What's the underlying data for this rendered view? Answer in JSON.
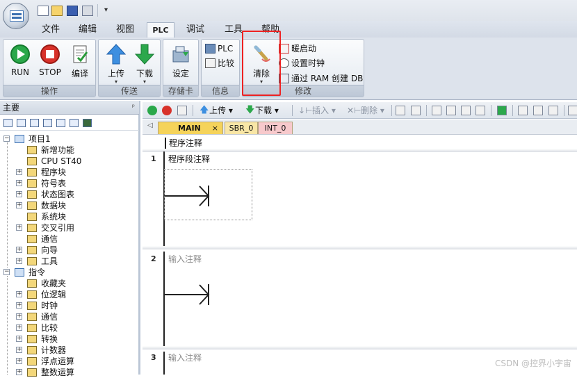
{
  "menu": {
    "tabs": [
      "文件",
      "编辑",
      "视图",
      "PLC",
      "调试",
      "工具",
      "帮助"
    ],
    "active_tab": "PLC"
  },
  "ribbon": {
    "groups": {
      "operate": {
        "label": "操作",
        "run": "RUN",
        "stop": "STOP",
        "compile": "编译"
      },
      "transfer": {
        "label": "传送",
        "upload": "上传",
        "download": "下载"
      },
      "memcard": {
        "label": "存储卡",
        "set": "设定"
      },
      "info": {
        "label": "信息",
        "plc": "PLC",
        "compare": "比较"
      },
      "modify": {
        "label": "修改",
        "clear": "清除",
        "warm_start": "暖启动",
        "set_clock": "设置时钟",
        "create_db": "通过 RAM 创建 DB"
      }
    }
  },
  "left_pane": {
    "title": "主要",
    "pin": "ᵖ",
    "tree": [
      {
        "label": "项目1",
        "level": 0,
        "expander": "−"
      },
      {
        "label": "新增功能",
        "level": 1,
        "expander": ""
      },
      {
        "label": "CPU ST40",
        "level": 1,
        "expander": ""
      },
      {
        "label": "程序块",
        "level": 1,
        "expander": "+"
      },
      {
        "label": "符号表",
        "level": 1,
        "expander": "+"
      },
      {
        "label": "状态图表",
        "level": 1,
        "expander": "+"
      },
      {
        "label": "数据块",
        "level": 1,
        "expander": "+"
      },
      {
        "label": "系统块",
        "level": 1,
        "expander": ""
      },
      {
        "label": "交叉引用",
        "level": 1,
        "expander": "+"
      },
      {
        "label": "通信",
        "level": 1,
        "expander": ""
      },
      {
        "label": "向导",
        "level": 1,
        "expander": "+"
      },
      {
        "label": "工具",
        "level": 1,
        "expander": "+"
      },
      {
        "label": "指令",
        "level": 0,
        "expander": "−"
      },
      {
        "label": "收藏夹",
        "level": 1,
        "expander": ""
      },
      {
        "label": "位逻辑",
        "level": 1,
        "expander": "+"
      },
      {
        "label": "时钟",
        "level": 1,
        "expander": "+"
      },
      {
        "label": "通信",
        "level": 1,
        "expander": "+"
      },
      {
        "label": "比较",
        "level": 1,
        "expander": "+"
      },
      {
        "label": "转换",
        "level": 1,
        "expander": "+"
      },
      {
        "label": "计数器",
        "level": 1,
        "expander": "+"
      },
      {
        "label": "浮点运算",
        "level": 1,
        "expander": "+"
      },
      {
        "label": "整数运算",
        "level": 1,
        "expander": "+"
      }
    ]
  },
  "editor": {
    "toolbar": {
      "upload": "上传",
      "download": "下载",
      "insert": "插入",
      "delete": "删除"
    },
    "tabs": [
      "MAIN",
      "SBR_0",
      "INT_0"
    ],
    "tab_close": "×",
    "nav_arrow": "◁",
    "program_comment": "程序注释",
    "networks": [
      {
        "number": "1",
        "comment": "程序段注释"
      },
      {
        "number": "2",
        "comment": "输入注释"
      },
      {
        "number": "3",
        "comment": "输入注释"
      }
    ]
  },
  "watermark": "CSDN @控界小宇宙",
  "colors": {
    "highlight": "#ee2222",
    "run_green": "#2aa84a",
    "stop_red": "#d8322a",
    "main_tab": "#f5d35a",
    "sbr_tab": "#f8e6a6",
    "int_tab": "#f7c9cc"
  }
}
